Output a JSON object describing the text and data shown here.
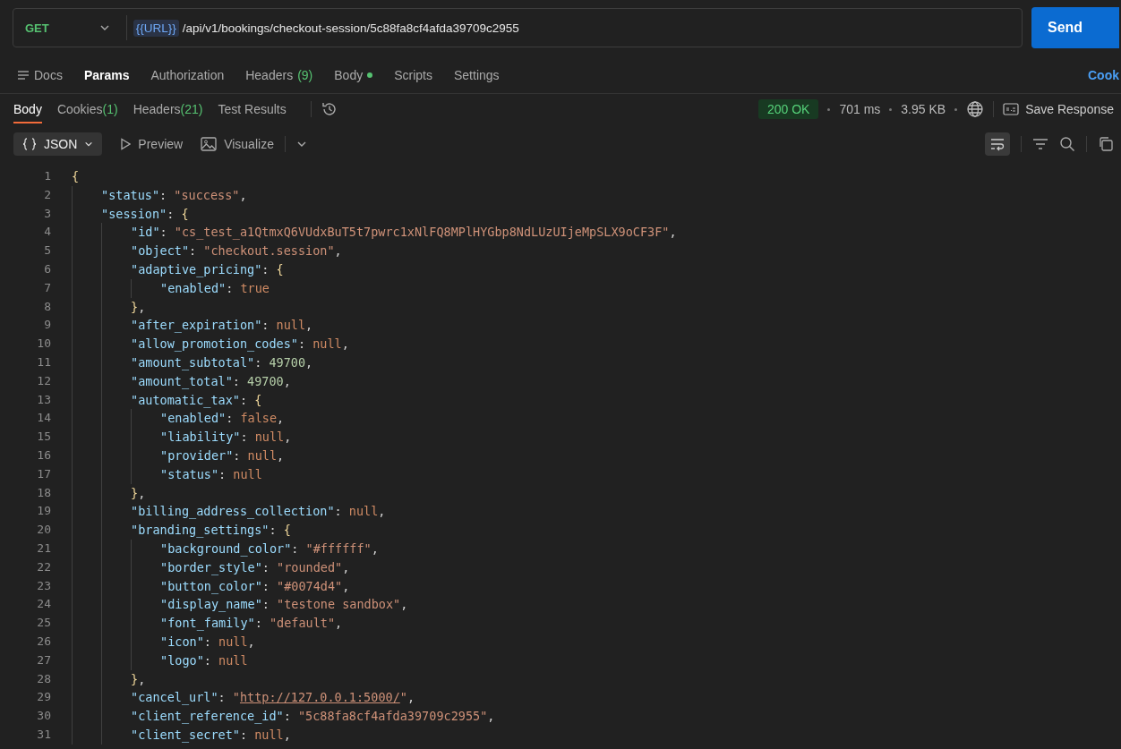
{
  "request": {
    "method": "GET",
    "url_variable": "{{URL}}",
    "url_path": "/api/v1/bookings/checkout-session/5c88fa8cf4afda39709c2955",
    "send_label": "Send"
  },
  "request_tabs": [
    {
      "label": "Docs",
      "selected": false,
      "dot": false
    },
    {
      "label": "Params",
      "selected": true,
      "dot": false
    },
    {
      "label": "Authorization",
      "selected": false,
      "dot": false
    },
    {
      "label": "Headers",
      "count": "(9)",
      "selected": false,
      "dot": false
    },
    {
      "label": "Body",
      "selected": false,
      "dot": true
    },
    {
      "label": "Scripts",
      "selected": false,
      "dot": false
    },
    {
      "label": "Settings",
      "selected": false,
      "dot": false
    }
  ],
  "cookies_link": "Cook",
  "response_tabs": [
    {
      "label": "Body",
      "selected": true
    },
    {
      "label": "Cookies",
      "count": "(1)",
      "selected": false
    },
    {
      "label": "Headers",
      "count": "(21)",
      "selected": false
    },
    {
      "label": "Test Results",
      "selected": false
    }
  ],
  "status": {
    "code": "200 OK",
    "time": "701 ms",
    "size": "3.95 KB",
    "save_label": "Save Response"
  },
  "view": {
    "format": "JSON",
    "preview": "Preview",
    "visualize": "Visualize",
    "wrap_on": true
  },
  "code": [
    {
      "n": "1",
      "t": [
        {
          "kind": "brace",
          "text": "{"
        }
      ],
      "children": [
        {
          "n": "2",
          "t": [
            {
              "kind": "key",
              "text": "\"status\""
            },
            {
              "kind": "p",
              "text": ": "
            },
            {
              "kind": "str",
              "text": "\"success\""
            },
            {
              "kind": "p",
              "text": ","
            }
          ]
        },
        {
          "n": "3",
          "t": [
            {
              "kind": "key",
              "text": "\"session\""
            },
            {
              "kind": "p",
              "text": ": "
            },
            {
              "kind": "brace",
              "text": "{"
            }
          ],
          "children": [
            {
              "n": "4",
              "t": [
                {
                  "kind": "key",
                  "text": "\"id\""
                },
                {
                  "kind": "p",
                  "text": ": "
                },
                {
                  "kind": "str",
                  "text": "\"cs_test_a1QtmxQ6VUdxBuT5t7pwrc1xNlFQ8MPlHYGbp8NdLUzUIjeMpSLX9oCF3F\""
                },
                {
                  "kind": "p",
                  "text": ","
                }
              ]
            },
            {
              "n": "5",
              "t": [
                {
                  "kind": "key",
                  "text": "\"object\""
                },
                {
                  "kind": "p",
                  "text": ": "
                },
                {
                  "kind": "str",
                  "text": "\"checkout.session\""
                },
                {
                  "kind": "p",
                  "text": ","
                }
              ]
            },
            {
              "n": "6",
              "t": [
                {
                  "kind": "key",
                  "text": "\"adaptive_pricing\""
                },
                {
                  "kind": "p",
                  "text": ": "
                },
                {
                  "kind": "brace",
                  "text": "{"
                }
              ],
              "children": [
                {
                  "n": "7",
                  "t": [
                    {
                      "kind": "key",
                      "text": "\"enabled\""
                    },
                    {
                      "kind": "p",
                      "text": ": "
                    },
                    {
                      "kind": "lit",
                      "text": "true"
                    }
                  ]
                }
              ]
            },
            {
              "n": "8",
              "t": [
                {
                  "kind": "brace",
                  "text": "}"
                },
                {
                  "kind": "p",
                  "text": ","
                }
              ]
            },
            {
              "n": "9",
              "t": [
                {
                  "kind": "key",
                  "text": "\"after_expiration\""
                },
                {
                  "kind": "p",
                  "text": ": "
                },
                {
                  "kind": "lit",
                  "text": "null"
                },
                {
                  "kind": "p",
                  "text": ","
                }
              ]
            },
            {
              "n": "10",
              "t": [
                {
                  "kind": "key",
                  "text": "\"allow_promotion_codes\""
                },
                {
                  "kind": "p",
                  "text": ": "
                },
                {
                  "kind": "lit",
                  "text": "null"
                },
                {
                  "kind": "p",
                  "text": ","
                }
              ]
            },
            {
              "n": "11",
              "t": [
                {
                  "kind": "key",
                  "text": "\"amount_subtotal\""
                },
                {
                  "kind": "p",
                  "text": ": "
                },
                {
                  "kind": "num",
                  "text": "49700"
                },
                {
                  "kind": "p",
                  "text": ","
                }
              ]
            },
            {
              "n": "12",
              "t": [
                {
                  "kind": "key",
                  "text": "\"amount_total\""
                },
                {
                  "kind": "p",
                  "text": ": "
                },
                {
                  "kind": "num",
                  "text": "49700"
                },
                {
                  "kind": "p",
                  "text": ","
                }
              ]
            },
            {
              "n": "13",
              "t": [
                {
                  "kind": "key",
                  "text": "\"automatic_tax\""
                },
                {
                  "kind": "p",
                  "text": ": "
                },
                {
                  "kind": "brace",
                  "text": "{"
                }
              ],
              "children": [
                {
                  "n": "14",
                  "t": [
                    {
                      "kind": "key",
                      "text": "\"enabled\""
                    },
                    {
                      "kind": "p",
                      "text": ": "
                    },
                    {
                      "kind": "lit",
                      "text": "false"
                    },
                    {
                      "kind": "p",
                      "text": ","
                    }
                  ]
                },
                {
                  "n": "15",
                  "t": [
                    {
                      "kind": "key",
                      "text": "\"liability\""
                    },
                    {
                      "kind": "p",
                      "text": ": "
                    },
                    {
                      "kind": "lit",
                      "text": "null"
                    },
                    {
                      "kind": "p",
                      "text": ","
                    }
                  ]
                },
                {
                  "n": "16",
                  "t": [
                    {
                      "kind": "key",
                      "text": "\"provider\""
                    },
                    {
                      "kind": "p",
                      "text": ": "
                    },
                    {
                      "kind": "lit",
                      "text": "null"
                    },
                    {
                      "kind": "p",
                      "text": ","
                    }
                  ]
                },
                {
                  "n": "17",
                  "t": [
                    {
                      "kind": "key",
                      "text": "\"status\""
                    },
                    {
                      "kind": "p",
                      "text": ": "
                    },
                    {
                      "kind": "lit",
                      "text": "null"
                    }
                  ]
                }
              ]
            },
            {
              "n": "18",
              "t": [
                {
                  "kind": "brace",
                  "text": "}"
                },
                {
                  "kind": "p",
                  "text": ","
                }
              ]
            },
            {
              "n": "19",
              "t": [
                {
                  "kind": "key",
                  "text": "\"billing_address_collection\""
                },
                {
                  "kind": "p",
                  "text": ": "
                },
                {
                  "kind": "lit",
                  "text": "null"
                },
                {
                  "kind": "p",
                  "text": ","
                }
              ]
            },
            {
              "n": "20",
              "t": [
                {
                  "kind": "key",
                  "text": "\"branding_settings\""
                },
                {
                  "kind": "p",
                  "text": ": "
                },
                {
                  "kind": "brace",
                  "text": "{"
                }
              ],
              "children": [
                {
                  "n": "21",
                  "t": [
                    {
                      "kind": "key",
                      "text": "\"background_color\""
                    },
                    {
                      "kind": "p",
                      "text": ": "
                    },
                    {
                      "kind": "str",
                      "text": "\"#ffffff\""
                    },
                    {
                      "kind": "p",
                      "text": ","
                    }
                  ]
                },
                {
                  "n": "22",
                  "t": [
                    {
                      "kind": "key",
                      "text": "\"border_style\""
                    },
                    {
                      "kind": "p",
                      "text": ": "
                    },
                    {
                      "kind": "str",
                      "text": "\"rounded\""
                    },
                    {
                      "kind": "p",
                      "text": ","
                    }
                  ]
                },
                {
                  "n": "23",
                  "t": [
                    {
                      "kind": "key",
                      "text": "\"button_color\""
                    },
                    {
                      "kind": "p",
                      "text": ": "
                    },
                    {
                      "kind": "str",
                      "text": "\"#0074d4\""
                    },
                    {
                      "kind": "p",
                      "text": ","
                    }
                  ]
                },
                {
                  "n": "24",
                  "t": [
                    {
                      "kind": "key",
                      "text": "\"display_name\""
                    },
                    {
                      "kind": "p",
                      "text": ": "
                    },
                    {
                      "kind": "str",
                      "text": "\"testone sandbox\""
                    },
                    {
                      "kind": "p",
                      "text": ","
                    }
                  ]
                },
                {
                  "n": "25",
                  "t": [
                    {
                      "kind": "key",
                      "text": "\"font_family\""
                    },
                    {
                      "kind": "p",
                      "text": ": "
                    },
                    {
                      "kind": "str",
                      "text": "\"default\""
                    },
                    {
                      "kind": "p",
                      "text": ","
                    }
                  ]
                },
                {
                  "n": "26",
                  "t": [
                    {
                      "kind": "key",
                      "text": "\"icon\""
                    },
                    {
                      "kind": "p",
                      "text": ": "
                    },
                    {
                      "kind": "lit",
                      "text": "null"
                    },
                    {
                      "kind": "p",
                      "text": ","
                    }
                  ]
                },
                {
                  "n": "27",
                  "t": [
                    {
                      "kind": "key",
                      "text": "\"logo\""
                    },
                    {
                      "kind": "p",
                      "text": ": "
                    },
                    {
                      "kind": "lit",
                      "text": "null"
                    }
                  ]
                }
              ]
            },
            {
              "n": "28",
              "t": [
                {
                  "kind": "brace",
                  "text": "}"
                },
                {
                  "kind": "p",
                  "text": ","
                }
              ]
            },
            {
              "n": "29",
              "t": [
                {
                  "kind": "key",
                  "text": "\"cancel_url\""
                },
                {
                  "kind": "p",
                  "text": ": "
                },
                {
                  "kind": "str",
                  "text": "\""
                },
                {
                  "kind": "link",
                  "text": "http://127.0.0.1:5000/"
                },
                {
                  "kind": "str",
                  "text": "\""
                },
                {
                  "kind": "p",
                  "text": ","
                }
              ]
            },
            {
              "n": "30",
              "t": [
                {
                  "kind": "key",
                  "text": "\"client_reference_id\""
                },
                {
                  "kind": "p",
                  "text": ": "
                },
                {
                  "kind": "str",
                  "text": "\"5c88fa8cf4afda39709c2955\""
                },
                {
                  "kind": "p",
                  "text": ","
                }
              ]
            },
            {
              "n": "31",
              "t": [
                {
                  "kind": "key",
                  "text": "\"client_secret\""
                },
                {
                  "kind": "p",
                  "text": ": "
                },
                {
                  "kind": "lit",
                  "text": "null"
                },
                {
                  "kind": "p",
                  "text": ","
                }
              ]
            }
          ]
        }
      ]
    }
  ]
}
